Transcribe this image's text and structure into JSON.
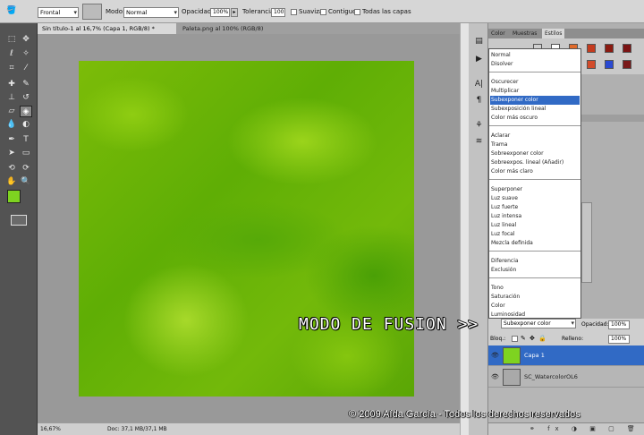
{
  "options_bar": {
    "preset": "Frontal",
    "mode_label": "Modo:",
    "mode_value": "Normal",
    "opacity_label": "Opacidad:",
    "opacity_value": "100%",
    "tolerance_label": "Tolerancia:",
    "tolerance_value": "100",
    "antialias_label": "Suavizar",
    "contiguous_label": "Contiguo",
    "all_layers_label": "Todas las capas"
  },
  "tabs": [
    {
      "label": "Sin título-1 al 16,7% (Capa 1, RGB/8) *",
      "active": true
    },
    {
      "label": "Paleta.png al 100% (RGB/8)",
      "active": false
    }
  ],
  "status": {
    "zoom": "16,67%",
    "doc": "Doc: 37,1 MB/37,1 MB"
  },
  "panel_tabs": [
    "Color",
    "Muestras",
    "Estilos"
  ],
  "blend_menu": {
    "groups": [
      [
        "Normal",
        "Disolver"
      ],
      [
        "Oscurecer",
        "Multiplicar",
        "Subexponer color",
        "Subexposición lineal",
        "Color más oscuro"
      ],
      [
        "Aclarar",
        "Trama",
        "Sobreexponer color",
        "Sobreexpos. lineal (Añadir)",
        "Color más claro"
      ],
      [
        "Superponer",
        "Luz suave",
        "Luz fuerte",
        "Luz intensa",
        "Luz lineal",
        "Luz focal",
        "Mezcla definida"
      ],
      [
        "Diferencia",
        "Exclusión"
      ],
      [
        "Tono",
        "Saturación",
        "Color",
        "Luminosidad"
      ]
    ],
    "highlighted": "Subexponer color"
  },
  "layers_panel": {
    "mode_value": "Subexponer color",
    "opacity_label": "Opacidad:",
    "opacity_value": "100%",
    "lock_label": "Bloq.:",
    "fill_label": "Relleno:",
    "fill_value": "100%",
    "layers": [
      {
        "name": "Capa 1",
        "active": true
      },
      {
        "name": "SC_WatercolorOL6",
        "active": false
      }
    ]
  },
  "annotation": "MODO DE FUSION",
  "annotation_arrow": ">>",
  "copyright": "© 2009 Aída García - Todos los derechos reservados",
  "colors": {
    "foreground": "#7ed320",
    "highlight": "#316ac5",
    "canvas": "#6cb406"
  }
}
